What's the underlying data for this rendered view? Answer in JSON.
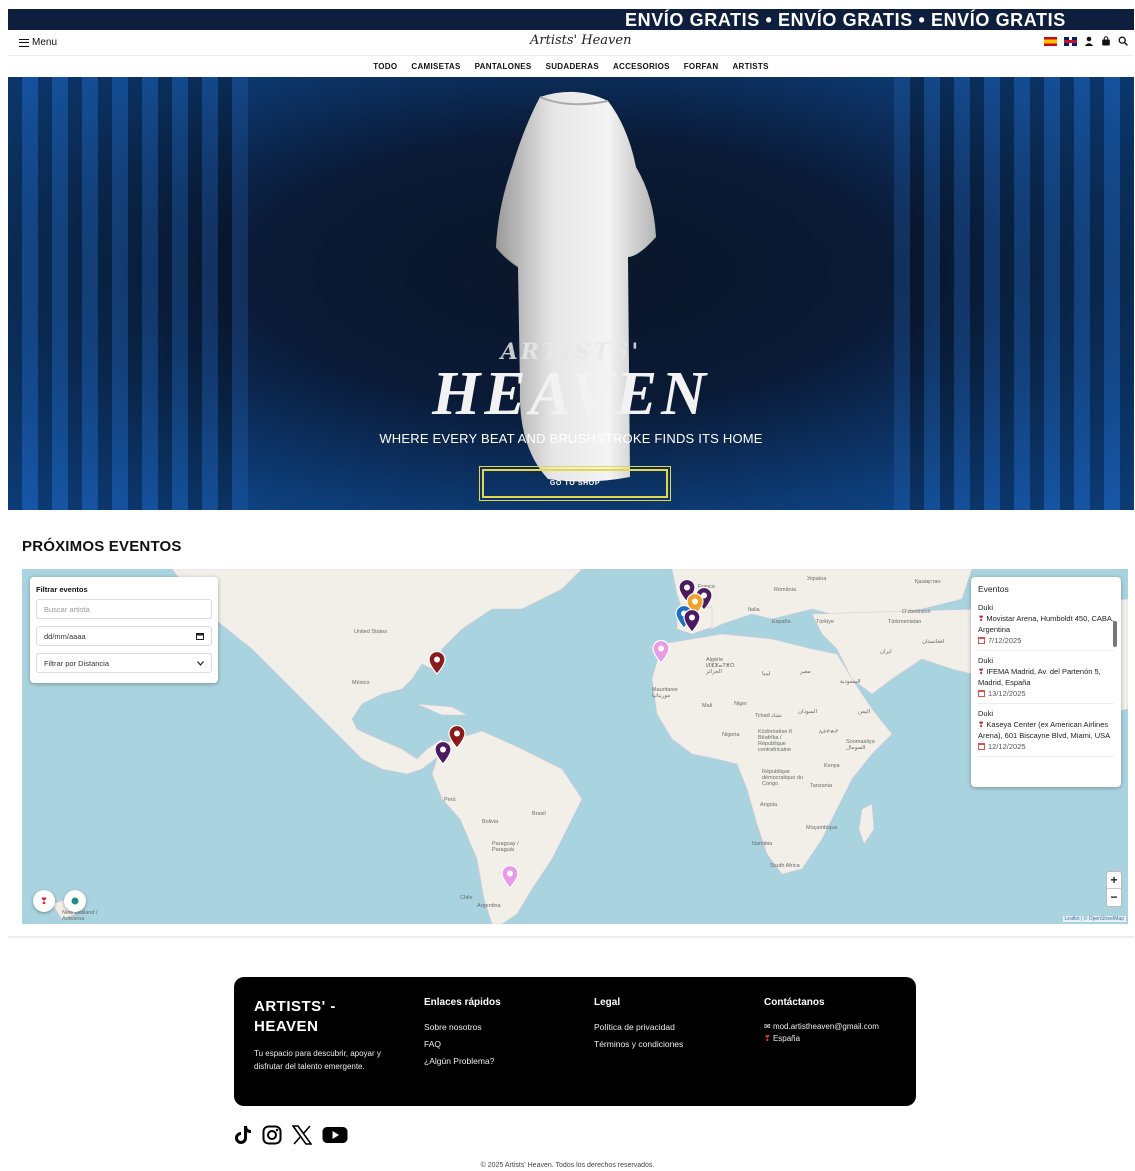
{
  "promo": {
    "text": "ENVÍO GRATIS  •  ENVÍO GRATIS  •  ENVÍO GRATIS"
  },
  "header": {
    "menu_label": "Menu",
    "logo_text": "Artists' Heaven",
    "icons": [
      "spain-flag-icon",
      "uk-flag-icon",
      "user-icon",
      "bag-icon",
      "search-icon"
    ]
  },
  "categories": [
    "TODO",
    "CAMISETAS",
    "PANTALONES",
    "SUDADERAS",
    "ACCESORIOS",
    "FORFAN",
    "ARTISTS"
  ],
  "hero": {
    "subtitle": "ARTISTS'",
    "title": "HEAVEN",
    "tagline": "WHERE EVERY BEAT AND BRUSHSTROKE FINDS ITS HOME",
    "cta": "GO TO SHOP"
  },
  "events": {
    "section_title": "PRÓXIMOS EVENTOS",
    "filter": {
      "title": "Filtrar eventos",
      "search_placeholder": "Buscar artista",
      "date_placeholder": "dd/mm/aaaa",
      "distance_option": "Filtrar por Distancia"
    },
    "panel_title": "Eventos",
    "list": [
      {
        "artist": "Duki",
        "venue": "Movistar Arena, Humboldt 450, CABA, Argentina",
        "date": "7/12/2025"
      },
      {
        "artist": "Duki",
        "venue": "IFEMA Madrid, Av. del Partenón 5, Madrid, España",
        "date": "13/12/2025"
      },
      {
        "artist": "Duki",
        "venue": "Kaseya Center (ex American Airlines Arena), 601 Biscayne Blvd, Miami, USA",
        "date": "12/12/2025"
      }
    ],
    "map_labels": {
      "us": "United States",
      "mx": "México",
      "br": "Brasil",
      "pe": "Perú",
      "bo": "Bolivia",
      "py": "Paraguay / Paraguái",
      "ar": "Argentina",
      "cl": "Chile",
      "nz": "New Zealand / Aotearoa",
      "fr": "France",
      "it": "Italia",
      "es": "España",
      "tr": "Türkiye",
      "ro": "România",
      "ua": "Україна",
      "kz": "Қазақстан",
      "uz": "O‘zbekiston",
      "tm": "Türkmenistan",
      "ir": "ایران",
      "af": "افغانستان",
      "dz": "Algérie ⵍⵣⵣⴰⵢⴻⵔ الجزائر",
      "ly": "ليبيا",
      "eg": "مصر",
      "sa": "السعودية",
      "ye": "اليمن",
      "mr": "Mauritanie موريتانيا",
      "ml": "Mali",
      "ne": "Niger",
      "td": "Tchad تشاد",
      "sd": "السودان",
      "ng": "Nigeria",
      "cf": "Ködörösêse tî Bêafrîka / République centrafricaine",
      "et": "ኢትዮጵያ",
      "so": "Soomaaliya الصومال",
      "ke": "Kenya",
      "cd": "République démocratique du Congo",
      "tz": "Tanzania",
      "ao": "Angola",
      "mz": "Moçambique",
      "na": "Namibia",
      "za": "South Africa"
    },
    "zoom_in": "+",
    "zoom_out": "−",
    "attribution": "Leaflet | © OpenStreetMap"
  },
  "footer": {
    "brand": "ARTISTS' - HEAVEN",
    "description": "Tu espacio para descubrir, apoyar y disfrutar del talento emergente.",
    "quick_title": "Enlaces rápidos",
    "quick_links": [
      "Sobre nosotros",
      "FAQ",
      "¿Algún Problema?"
    ],
    "legal_title": "Legal",
    "legal_links": [
      "Política de privacidad",
      "Términos y condiciones"
    ],
    "contact_title": "Contáctanos",
    "email": "mod.artistheaven@gmail.com",
    "location": "España",
    "social": [
      "tiktok-icon",
      "instagram-icon",
      "x-icon",
      "youtube-icon"
    ],
    "copyright": "© 2025 Artists' Heaven. Todos los derechos reservados."
  },
  "colors": {
    "navy": "#0d1f3c",
    "cta_border": "#e4d84a",
    "water": "#a9d3df",
    "land": "#f1efe8"
  }
}
